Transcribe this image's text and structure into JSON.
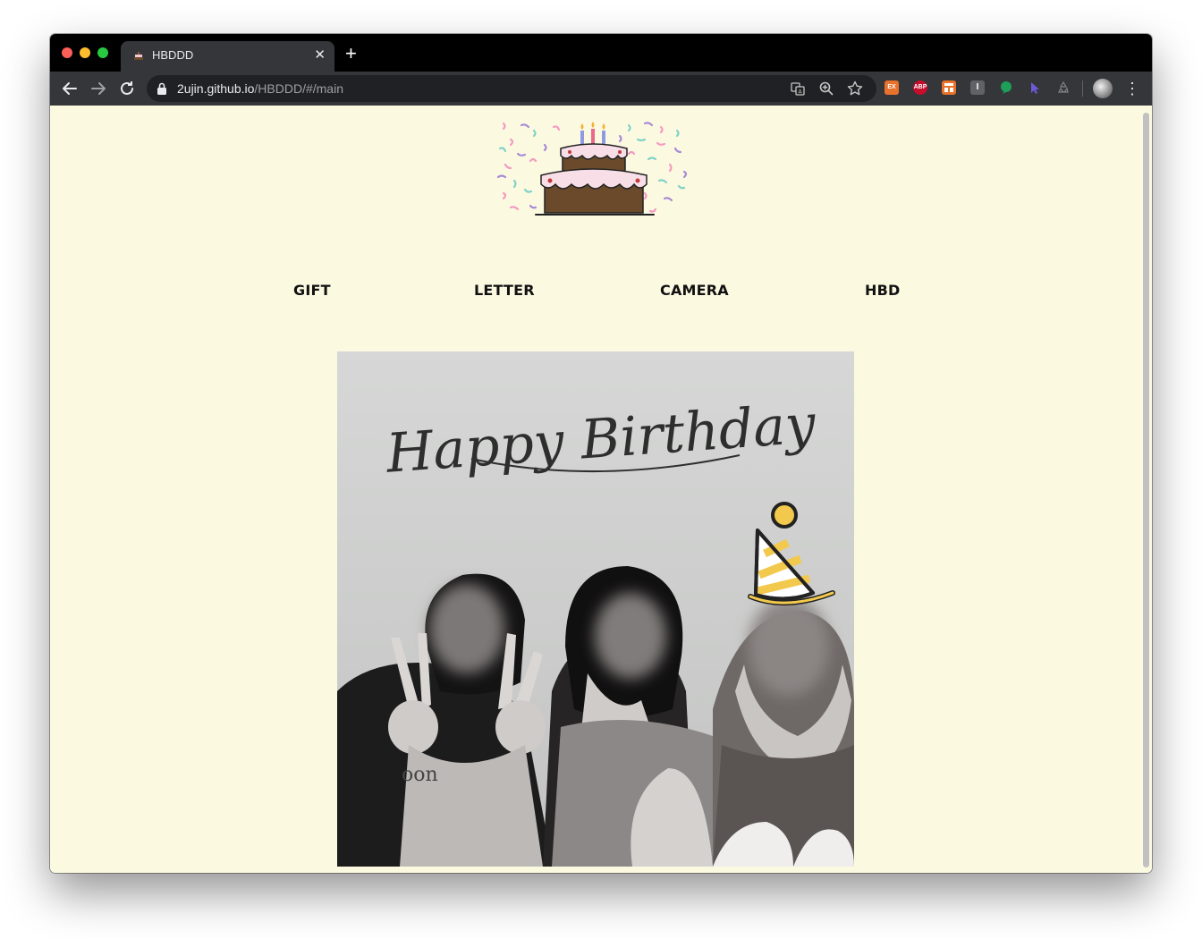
{
  "browser": {
    "tab_title": "HBDDD",
    "tab_favicon": "cake-favicon",
    "url_host": "2ujin.github.io",
    "url_path": "/HBDDD/#/main"
  },
  "toolbar_icons": [
    "back-icon",
    "forward-icon",
    "reload-icon",
    "translate-icon",
    "zoom-icon",
    "bookmark-star-icon"
  ],
  "extensions": [
    {
      "name": "ex-extension",
      "label": "EX",
      "color": "#e8712b"
    },
    {
      "name": "adblock-plus-extension",
      "label": "ABP",
      "color": "#c70d2c"
    },
    {
      "name": "layout-extension",
      "label": "",
      "color": "#e8712b"
    },
    {
      "name": "i-extension",
      "label": "I",
      "color": "#5f6368"
    },
    {
      "name": "green-balloon-extension",
      "label": "",
      "color": "#1e9e58"
    },
    {
      "name": "cursor-extension",
      "label": "",
      "color": "#6a5cd6"
    },
    {
      "name": "recycle-extension",
      "label": "",
      "color": "#5f6368"
    }
  ],
  "page": {
    "background": "#fcf9e1",
    "nav": {
      "gift": "GIFT",
      "letter": "LETTER",
      "camera": "CAMERA",
      "hbd": "HBD"
    },
    "photo": {
      "heading": "Happy Birthday",
      "description": "black-and-white photo of three people with blurred faces, one wearing a yellow party hat"
    }
  }
}
